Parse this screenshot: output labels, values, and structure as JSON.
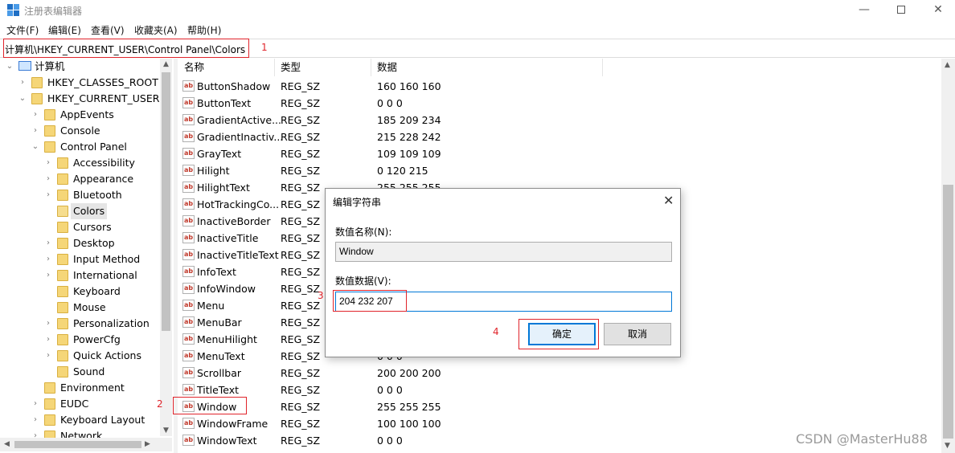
{
  "window": {
    "title": "注册表编辑器",
    "minimize_glyph": "—",
    "close_glyph": "✕"
  },
  "menu": [
    "文件(F)",
    "编辑(E)",
    "查看(V)",
    "收藏夹(A)",
    "帮助(H)"
  ],
  "address": "计算机\\HKEY_CURRENT_USER\\Control Panel\\Colors",
  "annotations": [
    "1",
    "2",
    "3",
    "4"
  ],
  "tree": {
    "root": "计算机",
    "items": [
      {
        "label": "HKEY_CLASSES_ROOT",
        "expander": "›"
      },
      {
        "label": "HKEY_CURRENT_USER",
        "expander": "⌄"
      },
      {
        "label": "AppEvents",
        "expander": "›"
      },
      {
        "label": "Console",
        "expander": "›"
      },
      {
        "label": "Control Panel",
        "expander": "⌄"
      },
      {
        "label": "Accessibility",
        "expander": "›"
      },
      {
        "label": "Appearance",
        "expander": "›"
      },
      {
        "label": "Bluetooth",
        "expander": "›"
      },
      {
        "label": "Colors",
        "expander": ""
      },
      {
        "label": "Cursors",
        "expander": ""
      },
      {
        "label": "Desktop",
        "expander": "›"
      },
      {
        "label": "Input Method",
        "expander": "›"
      },
      {
        "label": "International",
        "expander": "›"
      },
      {
        "label": "Keyboard",
        "expander": ""
      },
      {
        "label": "Mouse",
        "expander": ""
      },
      {
        "label": "Personalization",
        "expander": "›"
      },
      {
        "label": "PowerCfg",
        "expander": "›"
      },
      {
        "label": "Quick Actions",
        "expander": "›"
      },
      {
        "label": "Sound",
        "expander": ""
      },
      {
        "label": "Environment",
        "expander": ""
      },
      {
        "label": "EUDC",
        "expander": "›"
      },
      {
        "label": "Keyboard Layout",
        "expander": "›"
      },
      {
        "label": "Network",
        "expander": "›"
      }
    ]
  },
  "list": {
    "columns": [
      "名称",
      "类型",
      "数据"
    ],
    "rows": [
      {
        "name": "ButtonShadow",
        "type": "REG_SZ",
        "data": "160 160 160"
      },
      {
        "name": "ButtonText",
        "type": "REG_SZ",
        "data": "0 0 0"
      },
      {
        "name": "GradientActive...",
        "type": "REG_SZ",
        "data": "185 209 234"
      },
      {
        "name": "GradientInactiv...",
        "type": "REG_SZ",
        "data": "215 228 242"
      },
      {
        "name": "GrayText",
        "type": "REG_SZ",
        "data": "109 109 109"
      },
      {
        "name": "Hilight",
        "type": "REG_SZ",
        "data": "0 120 215"
      },
      {
        "name": "HilightText",
        "type": "REG_SZ",
        "data": "255 255 255"
      },
      {
        "name": "HotTrackingCo...",
        "type": "REG_SZ",
        "data": ""
      },
      {
        "name": "InactiveBorder",
        "type": "REG_SZ",
        "data": ""
      },
      {
        "name": "InactiveTitle",
        "type": "REG_SZ",
        "data": ""
      },
      {
        "name": "InactiveTitleText",
        "type": "REG_SZ",
        "data": ""
      },
      {
        "name": "InfoText",
        "type": "REG_SZ",
        "data": ""
      },
      {
        "name": "InfoWindow",
        "type": "REG_SZ",
        "data": ""
      },
      {
        "name": "Menu",
        "type": "REG_SZ",
        "data": ""
      },
      {
        "name": "MenuBar",
        "type": "REG_SZ",
        "data": ""
      },
      {
        "name": "MenuHilight",
        "type": "REG_SZ",
        "data": ""
      },
      {
        "name": "MenuText",
        "type": "REG_SZ",
        "data": "0 0 0"
      },
      {
        "name": "Scrollbar",
        "type": "REG_SZ",
        "data": "200 200 200"
      },
      {
        "name": "TitleText",
        "type": "REG_SZ",
        "data": "0 0 0"
      },
      {
        "name": "Window",
        "type": "REG_SZ",
        "data": "255 255 255"
      },
      {
        "name": "WindowFrame",
        "type": "REG_SZ",
        "data": "100 100 100"
      },
      {
        "name": "WindowText",
        "type": "REG_SZ",
        "data": "0 0 0"
      }
    ]
  },
  "dialog": {
    "title": "编辑字符串",
    "value_name_label": "数值名称(N):",
    "value_name": "Window",
    "value_data_label": "数值数据(V):",
    "value_data": "204 232 207",
    "ok": "确定",
    "cancel": "取消",
    "close_glyph": "✕"
  },
  "watermark": "CSDN @MasterHu88",
  "colors": {
    "annotation": "#e0242b",
    "accent": "#0078d7",
    "folder": "#f5d678"
  }
}
